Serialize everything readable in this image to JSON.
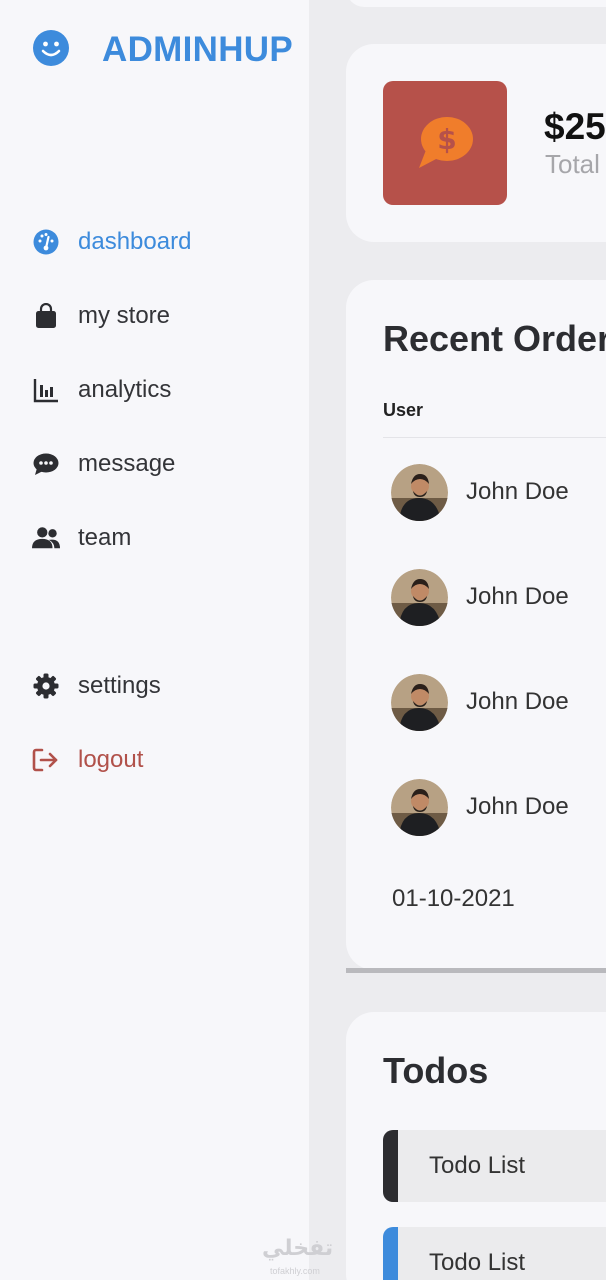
{
  "brand": {
    "name": "ADMINHUP",
    "icon": "smiley-icon",
    "color": "#3d8bdc"
  },
  "sidebar": {
    "items": [
      {
        "label": "dashboard",
        "icon": "dashboard-gauge-icon",
        "active": true
      },
      {
        "label": "my store",
        "icon": "shopping-bag-icon"
      },
      {
        "label": "analytics",
        "icon": "bar-chart-icon"
      },
      {
        "label": "message",
        "icon": "chat-bubble-icon"
      },
      {
        "label": "team",
        "icon": "users-icon"
      }
    ],
    "bottom_items": [
      {
        "label": "settings",
        "icon": "gear-icon"
      },
      {
        "label": "logout",
        "icon": "logout-icon",
        "color": "#b1514a"
      }
    ]
  },
  "stat": {
    "value": "$25",
    "label": "Total",
    "icon": "dollar-chat-icon",
    "icon_bg": "#b6514a",
    "icon_color": "#f07d2b"
  },
  "orders": {
    "title": "Recent Orders",
    "columns": [
      "User"
    ],
    "rows": [
      {
        "name": "John Doe"
      },
      {
        "name": "John Doe"
      },
      {
        "name": "John Doe"
      },
      {
        "name": "John Doe"
      }
    ],
    "date": "01-10-2021"
  },
  "todos": {
    "title": "Todos",
    "items": [
      {
        "label": "Todo List",
        "accent": "#2c2c30"
      },
      {
        "label": "Todo List",
        "accent": "#3d8bdc"
      }
    ]
  },
  "watermark": {
    "text": "تفخلي",
    "sub": "tofakhly.com"
  }
}
